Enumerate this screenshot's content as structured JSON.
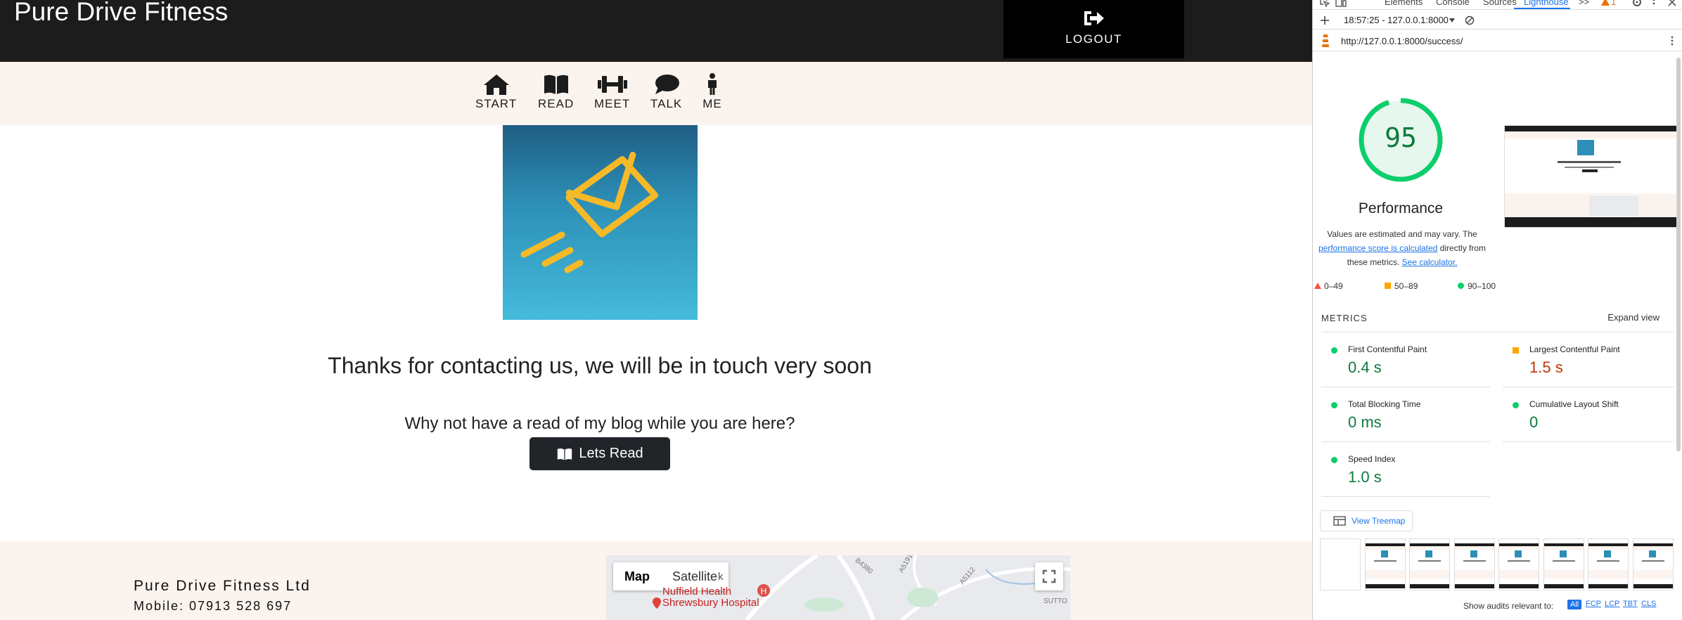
{
  "site": {
    "brand": "Pure Drive Fitness",
    "logout_label": "LOGOUT",
    "nav": [
      {
        "label": "START",
        "icon": "home-icon"
      },
      {
        "label": "READ",
        "icon": "book-icon"
      },
      {
        "label": "MEET",
        "icon": "dumbbell-icon"
      },
      {
        "label": "TALK",
        "icon": "chat-icon"
      },
      {
        "label": "ME",
        "icon": "person-icon"
      }
    ],
    "thanks": "Thanks for contacting us, we will be in touch very soon",
    "why_read": "Why not have a read of my blog while you are here?",
    "read_button": "Lets Read",
    "footer": {
      "company": "Pure Drive Fitness Ltd",
      "mobile": "Mobile: 07913 528 697",
      "map_tab": "Map",
      "satellite_tab": "Satellite",
      "hospital": "Nuffield Health\nShrewsbury Hospital",
      "road_a5191": "A5191",
      "road_a5112": "A5112",
      "road_b4380": "B4380",
      "place_sutton": "SUTTO",
      "map_k": "k"
    },
    "colors": {
      "topbar": "#1c1c1c",
      "navbar": "#fbf3ee",
      "button": "#212529"
    }
  },
  "devtools": {
    "tabs": [
      "Elements",
      "Console",
      "Sources",
      "Lighthouse"
    ],
    "active_tab": "Lighthouse",
    "more_tabs": ">>",
    "warning_count": "1",
    "report_select": "18:57:25 - 127.0.0.1:8000",
    "url": "http://127.0.0.1:8000/success/",
    "score": "95",
    "score_fraction": 0.95,
    "category": "Performance",
    "note_prefix": "Values are estimated and may vary. The",
    "note_link": "performance score is calculated",
    "note_mid": "directly from these metrics.",
    "note_calc": "See calculator.",
    "legend": [
      {
        "label": "0–49",
        "color": "#ff4e42"
      },
      {
        "label": "50–89",
        "color": "#ffa400"
      },
      {
        "label": "90–100",
        "color": "#0cce6b"
      }
    ],
    "metrics_heading": "METRICS",
    "expand_view": "Expand view",
    "metrics": [
      {
        "name": "First Contentful Paint",
        "value": "0.4 s",
        "status": "pass"
      },
      {
        "name": "Largest Contentful Paint",
        "value": "1.5 s",
        "status": "average"
      },
      {
        "name": "Total Blocking Time",
        "value": "0 ms",
        "status": "pass"
      },
      {
        "name": "Cumulative Layout Shift",
        "value": "0",
        "status": "pass"
      },
      {
        "name": "Speed Index",
        "value": "1.0 s",
        "status": "pass"
      }
    ],
    "view_treemap": "View Treemap",
    "show_audits": "Show audits relevant to:",
    "audit_filters": [
      "All",
      "FCP",
      "LCP",
      "TBT",
      "CLS"
    ]
  }
}
